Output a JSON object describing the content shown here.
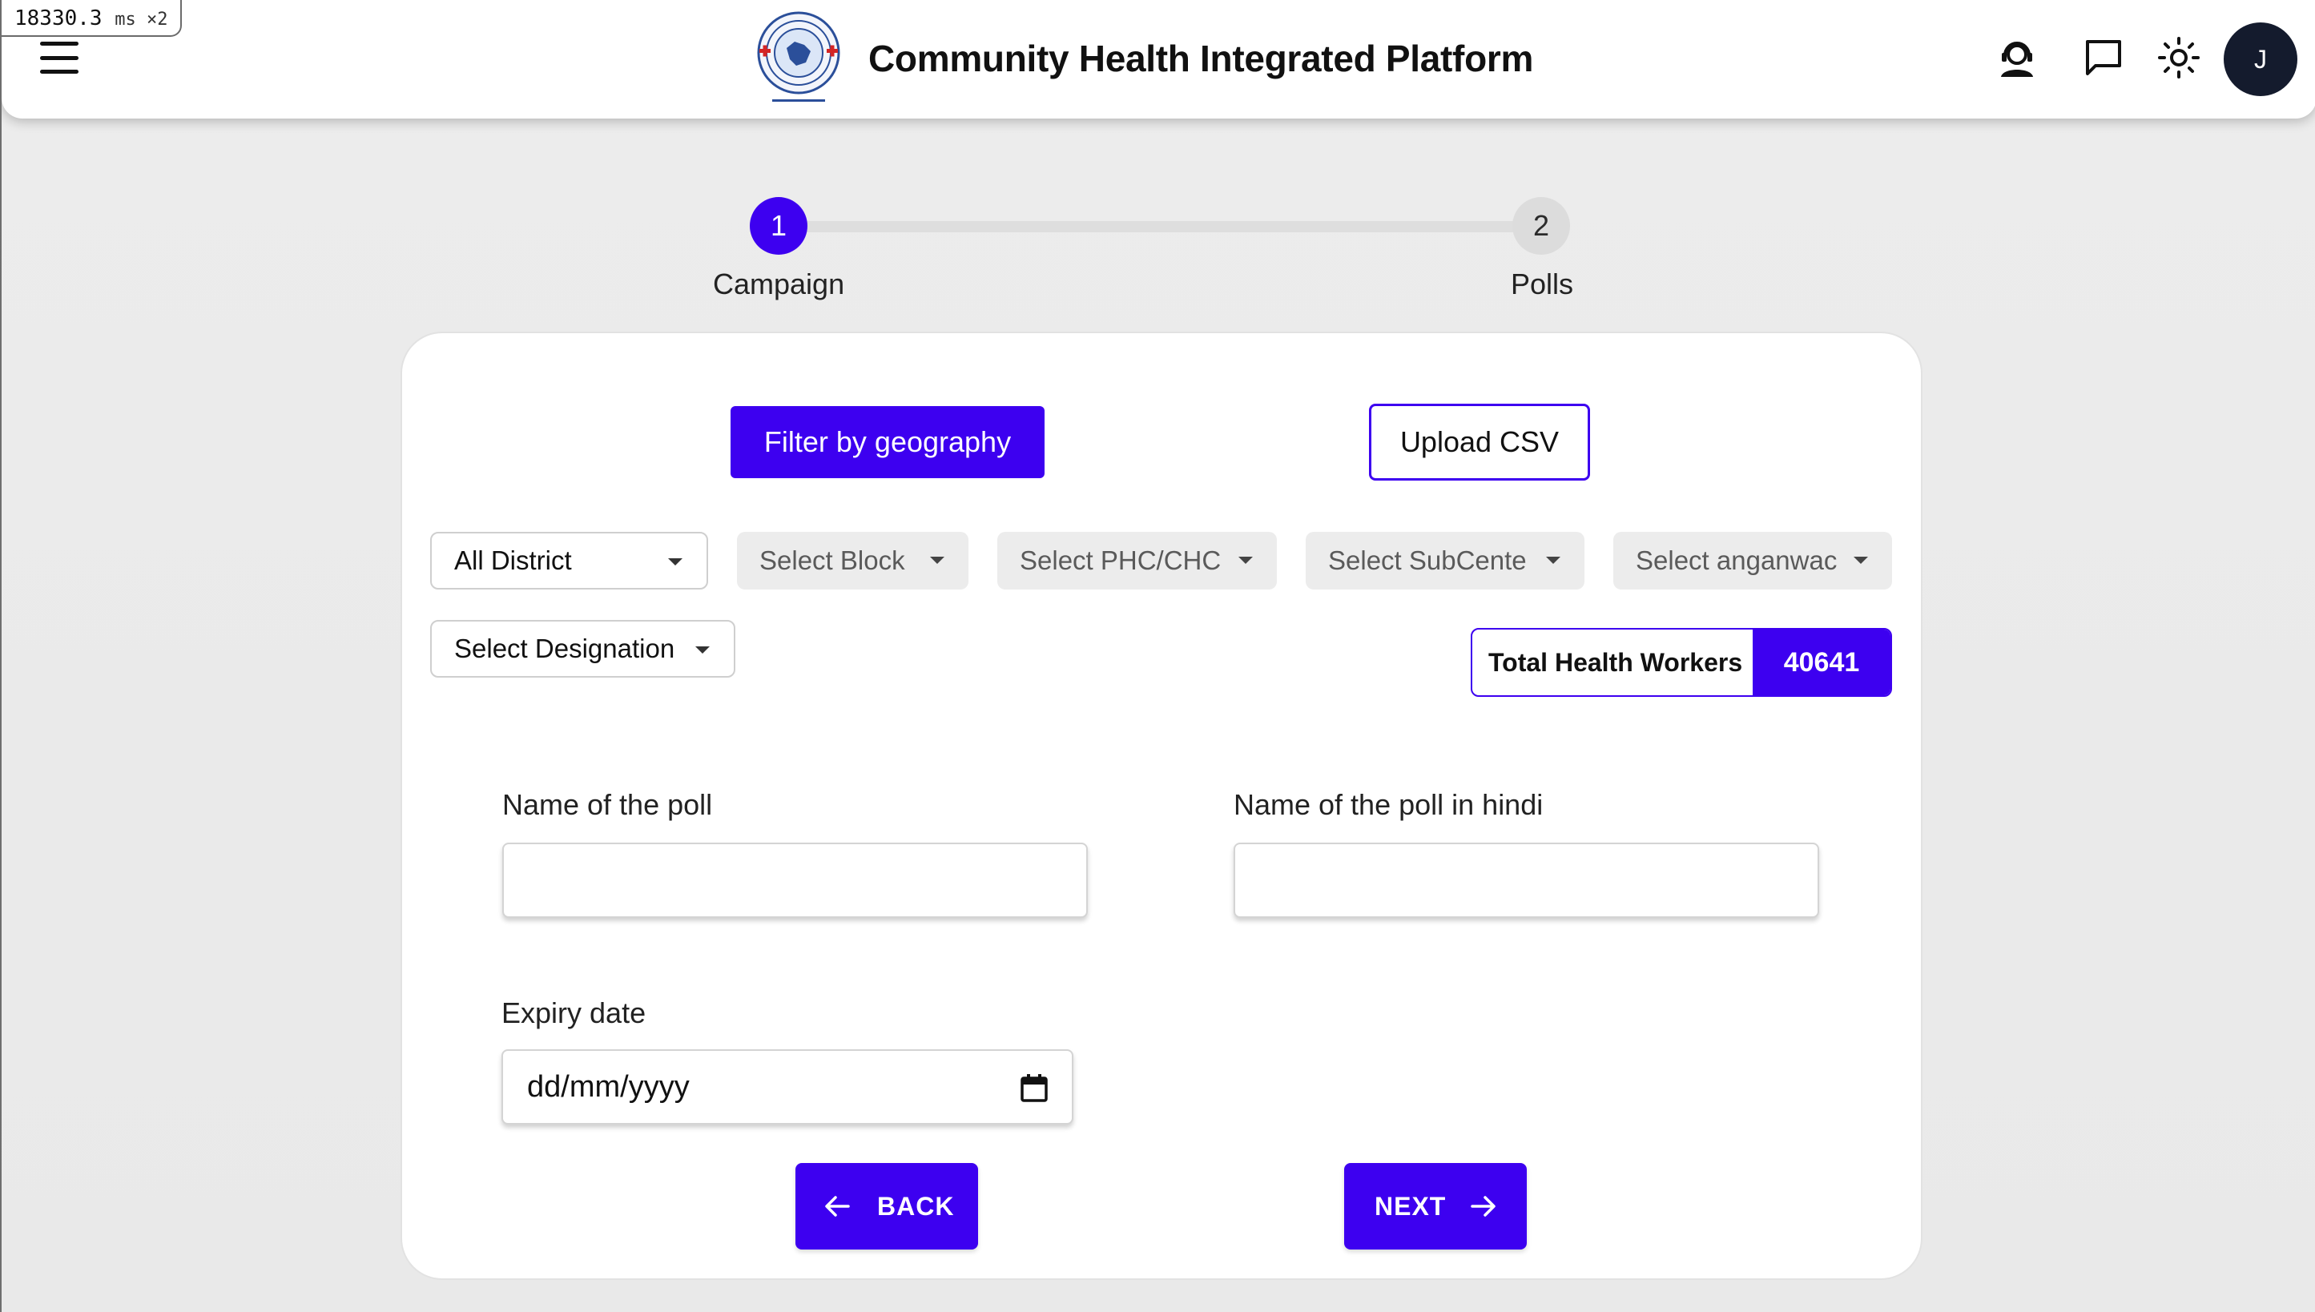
{
  "perf": {
    "value": "18330.3",
    "unit": "ms ×2"
  },
  "header": {
    "title": "Community Health Integrated Platform",
    "avatar_initial": "J"
  },
  "stepper": {
    "steps": [
      {
        "number": "1",
        "label": "Campaign",
        "active": true
      },
      {
        "number": "2",
        "label": "Polls",
        "active": false
      }
    ]
  },
  "tabs": {
    "filter_label": "Filter by geography",
    "upload_label": "Upload CSV"
  },
  "filters": {
    "district": "All District",
    "block": "Select Block",
    "phc": "Select PHC/CHC",
    "subcenter": "Select SubCente",
    "anganwadi": "Select anganwac",
    "designation": "Select Designation"
  },
  "total": {
    "label": "Total Health Workers",
    "value": "40641"
  },
  "form": {
    "poll_name_label": "Name of the poll",
    "poll_name_value": "",
    "poll_hindi_label": "Name of the poll in hindi",
    "poll_hindi_value": "",
    "expiry_label": "Expiry date",
    "expiry_placeholder": "dd/mm/yyyy"
  },
  "actions": {
    "back_label": "BACK",
    "next_label": "NEXT"
  },
  "colors": {
    "accent": "#3d00f0",
    "avatar_bg": "#141b2d",
    "page_bg": "#ebebeb"
  }
}
